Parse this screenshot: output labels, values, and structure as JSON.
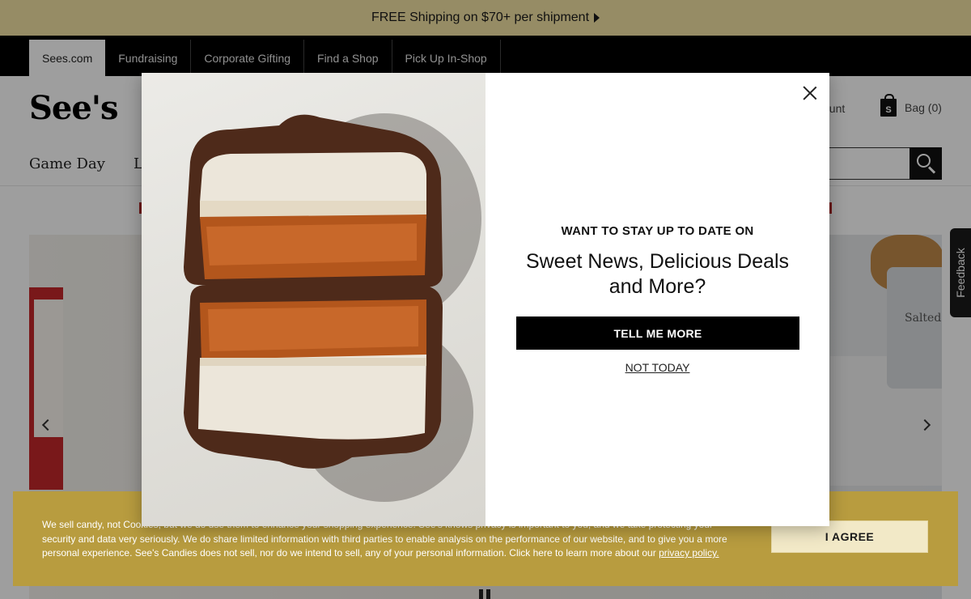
{
  "promo": {
    "text": "FREE Shipping on $70+ per shipment"
  },
  "utility_nav": {
    "tabs": [
      "Sees.com",
      "Fundraising",
      "Corporate Gifting",
      "Find a Shop",
      "Pick Up In-Shop"
    ]
  },
  "header": {
    "logo_text": "See's",
    "account_label": "count",
    "bag_label": "Bag (0)",
    "bag_icon_letter": "S",
    "nav": [
      "Game Day",
      "L"
    ]
  },
  "hero": {
    "tin_label": "Salted"
  },
  "feedback": {
    "label": "Feedback"
  },
  "modal": {
    "eyebrow": "WANT TO STAY UP TO DATE ON",
    "headline": "Sweet News, Delicious Deals and More?",
    "cta_label": "TELL ME MORE",
    "decline_label": "NOT TODAY"
  },
  "cookie": {
    "text": "We sell candy, not Cookies, but we do use them to enhance your shopping experience. See's knows privacy is important to you, and we take protecting your security and data very seriously. We do share limited information with third parties to enable analysis on the performance of our website, and to give you a more personal experience. See's Candies does not sell, nor do we intend to sell, any of your personal information. Click here to learn more about our",
    "link": "privacy policy.",
    "agree_label": "I AGREE"
  },
  "colors": {
    "promo_bg": "#f2e2a3",
    "nav_bg": "#000000",
    "cookie_bg": "#b89c3f",
    "cta_bg": "#000000"
  }
}
